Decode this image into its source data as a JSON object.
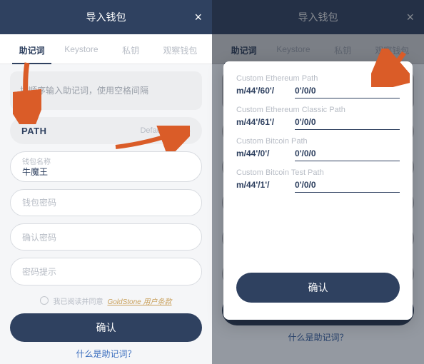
{
  "header": {
    "title": "导入钱包",
    "close_glyph": "×"
  },
  "tabs": [
    "助记词",
    "Keystore",
    "私钥",
    "观察钱包"
  ],
  "left": {
    "mnemonic_placeholder": "按顺序输入助记词，使用空格间隔",
    "path_label": "PATH",
    "path_value": "Default Path",
    "wallet_name_label": "钱包名称",
    "wallet_name_value": "牛魔王",
    "wallet_pwd_placeholder": "钱包密码",
    "confirm_pwd_placeholder": "确认密码",
    "pwd_hint_placeholder": "密码提示",
    "terms_prefix": "我已阅读并同意",
    "terms_link": "GoldStone 用户条款",
    "confirm_btn": "确认",
    "bottom_link": "什么是助记词？"
  },
  "modal": {
    "sections": [
      {
        "label": "Custom Ethereum Path",
        "prefix": "m/44'/60'/",
        "suffix": "0'/0/0"
      },
      {
        "label": "Custom Ethereum Classic Path",
        "prefix": "m/44'/61'/",
        "suffix": "0'/0/0"
      },
      {
        "label": "Custom Bitcoin Path",
        "prefix": "m/44'/0'/",
        "suffix": "0'/0/0"
      },
      {
        "label": "Custom Bitcoin Test Path",
        "prefix": "m/44'/1'/",
        "suffix": "0'/0/0"
      }
    ],
    "confirm_btn": "确认"
  },
  "colors": {
    "brand": "#2f4160",
    "arrow": "#da5c28"
  }
}
